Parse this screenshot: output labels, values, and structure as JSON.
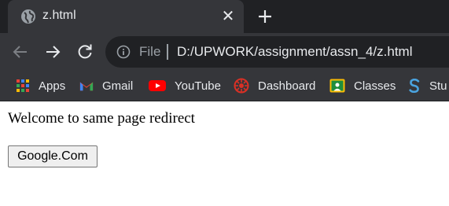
{
  "tab": {
    "title": "z.html",
    "close_glyph": "✕"
  },
  "toolbar": {
    "back_icon": "arrow-left-icon",
    "forward_icon": "arrow-right-icon",
    "reload_icon": "reload-icon"
  },
  "omnibox": {
    "scheme_label": "File",
    "url": "D:/UPWORK/assignment/assn_4/z.html"
  },
  "bookmarks": [
    {
      "label": "Apps",
      "icon": "apps-grid-icon"
    },
    {
      "label": "Gmail",
      "icon": "gmail-icon"
    },
    {
      "label": "YouTube",
      "icon": "youtube-icon"
    },
    {
      "label": "Dashboard",
      "icon": "dashboard-icon"
    },
    {
      "label": "Classes",
      "icon": "classes-icon"
    },
    {
      "label": "Stu",
      "icon": "stu-icon"
    }
  ],
  "page": {
    "welcome_text": "Welcome to same page redirect",
    "button_label": "Google.Com"
  },
  "colors": {
    "tab_strip": "#202124",
    "toolbar": "#35363a",
    "text_light": "#e8eaed",
    "youtube_red": "#ff0000"
  }
}
